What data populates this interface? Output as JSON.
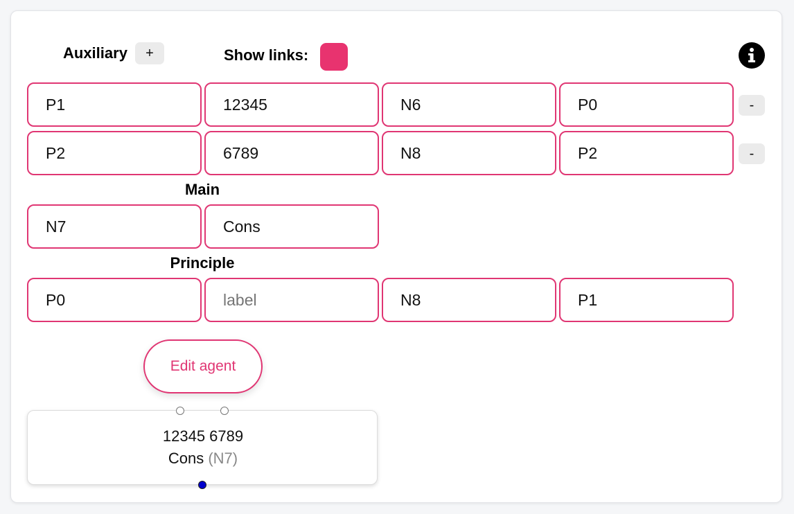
{
  "header": {
    "auxiliary_label": "Auxiliary",
    "auxiliary_add": "+",
    "show_links_label": "Show links:",
    "info_glyph": "i"
  },
  "colors": {
    "accent": "#e03673",
    "toggle_on": "#e8336f",
    "main_port": "#0000cc"
  },
  "auxiliary_rows": [
    {
      "fields": [
        "P1",
        "12345",
        "N6",
        "P0"
      ],
      "remove": "-"
    },
    {
      "fields": [
        "P2",
        "6789",
        "N8",
        "P2"
      ],
      "remove": "-"
    }
  ],
  "main": {
    "title": "Main",
    "fields": [
      "N7",
      "Cons"
    ]
  },
  "principle": {
    "title": "Principle",
    "fields": [
      "P0",
      "",
      "N8",
      "P1"
    ],
    "label_placeholder": "label"
  },
  "edit_button": "Edit agent",
  "agent_node": {
    "aux_labels": "12345 6789",
    "name": "Cons",
    "id": "(N7)"
  }
}
